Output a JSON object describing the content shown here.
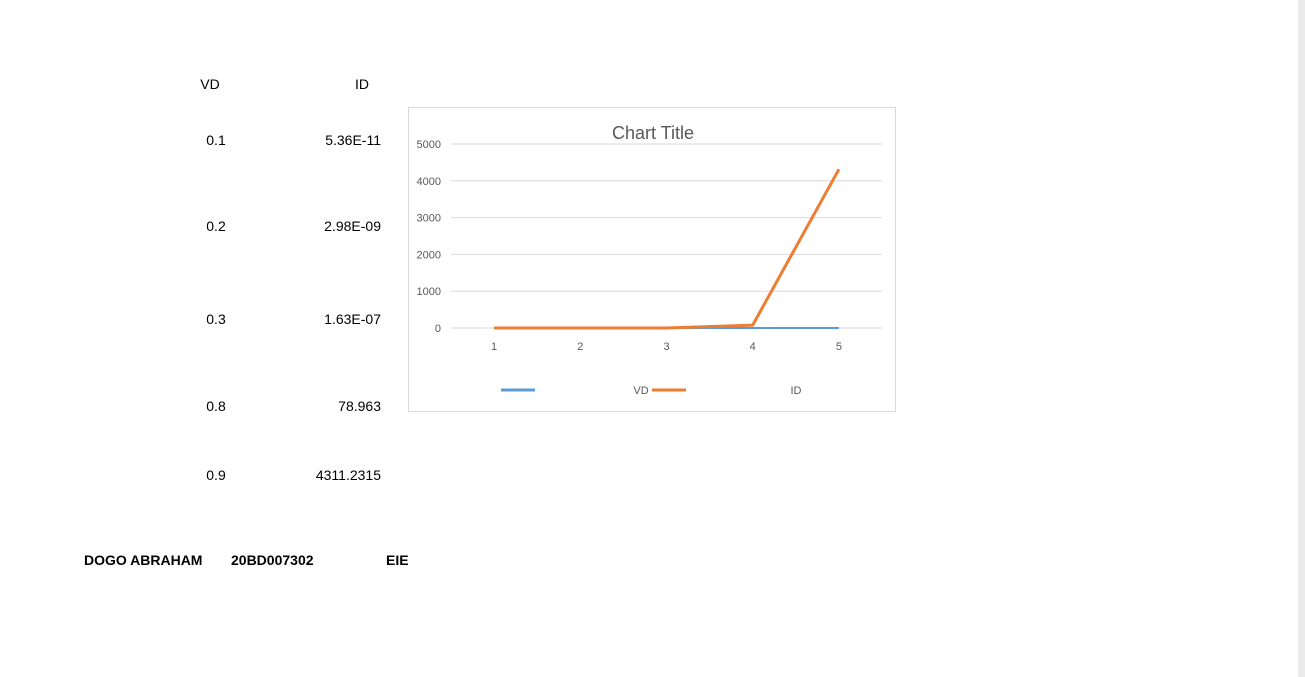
{
  "table": {
    "headers": {
      "vd": "VD",
      "id": "ID"
    },
    "rows": [
      {
        "vd": "0.1",
        "id": "5.36E-11"
      },
      {
        "vd": "0.2",
        "id": "2.98E-09"
      },
      {
        "vd": "0.3",
        "id": "1.63E-07"
      },
      {
        "vd": "0.8",
        "id": "78.963"
      },
      {
        "vd": "0.9",
        "id": "4311.2315"
      }
    ]
  },
  "footer": {
    "name": "DOGO ABRAHAM",
    "reg_no": "20BD007302",
    "dept": "EIE"
  },
  "chart_data": {
    "type": "line",
    "title": "Chart Title",
    "categories": [
      "1",
      "2",
      "3",
      "4",
      "5"
    ],
    "y_ticks": [
      "0",
      "1000",
      "2000",
      "3000",
      "4000",
      "5000"
    ],
    "ylim": [
      0,
      5000
    ],
    "grid": true,
    "legend_position": "bottom",
    "series": [
      {
        "name": "VD",
        "color": "#5b9bd5",
        "values": [
          0.1,
          0.2,
          0.3,
          0.8,
          0.9
        ]
      },
      {
        "name": "ID",
        "color": "#ed7d31",
        "values": [
          5.36e-11,
          2.98e-09,
          1.63e-07,
          78.963,
          4311.2315
        ]
      }
    ]
  }
}
